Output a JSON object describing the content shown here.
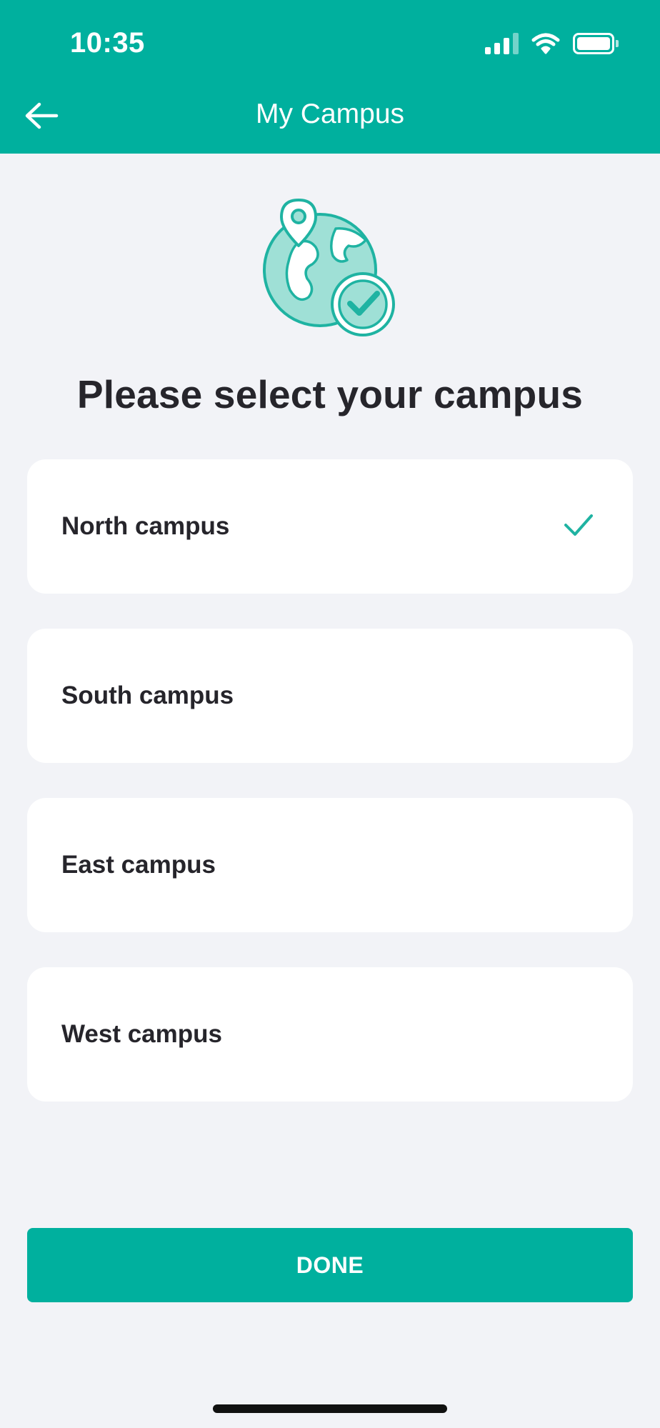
{
  "status_bar": {
    "time": "10:35",
    "icons": [
      "signal-icon",
      "wifi-icon",
      "battery-icon"
    ]
  },
  "nav": {
    "title": "My Campus",
    "back_icon": "arrow-left-icon"
  },
  "illustration": {
    "icon": "globe-location-check-icon"
  },
  "page": {
    "title": "Please select your campus"
  },
  "campuses": [
    {
      "label": "North campus",
      "selected": true
    },
    {
      "label": "South campus",
      "selected": false
    },
    {
      "label": "East campus",
      "selected": false
    },
    {
      "label": "West campus",
      "selected": false
    }
  ],
  "actions": {
    "done_label": "DONE"
  },
  "colors": {
    "primary": "#00b09e",
    "background": "#f2f3f7",
    "card": "#ffffff",
    "text": "#26252b",
    "illustration_fill": "#9fe0d6"
  }
}
